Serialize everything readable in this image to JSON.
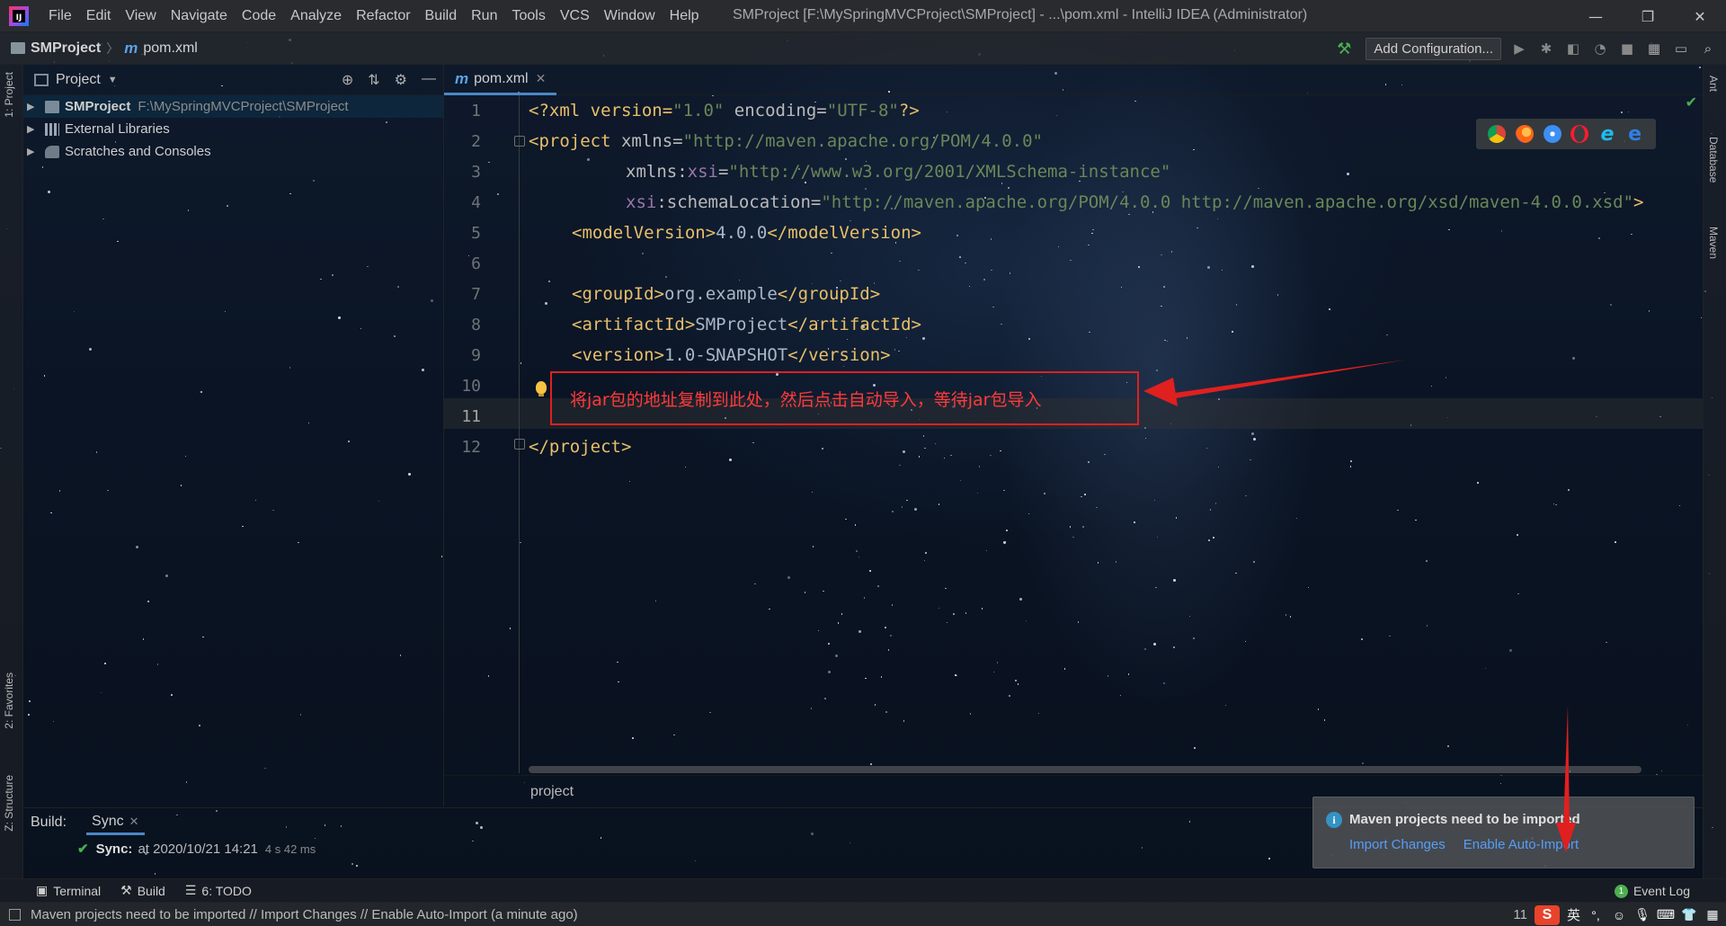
{
  "window": {
    "title": "SMProject [F:\\MySpringMVCProject\\SMProject] - ...\\pom.xml - IntelliJ IDEA (Administrator)",
    "controls": [
      "—",
      "❐",
      "✕"
    ]
  },
  "menu": [
    "File",
    "Edit",
    "View",
    "Navigate",
    "Code",
    "Analyze",
    "Refactor",
    "Build",
    "Run",
    "Tools",
    "VCS",
    "Window",
    "Help"
  ],
  "navbar": {
    "project": "SMProject",
    "file": "pom.xml",
    "add_configuration": "Add Configuration..."
  },
  "left_stripe": {
    "project_tab": "1: Project",
    "favorites_tab": "2: Favorites",
    "structure_tab": "Z: Structure"
  },
  "right_stripe": {
    "ant_tab": "Ant",
    "database_tab": "Database",
    "maven_tab": "Maven"
  },
  "project_panel": {
    "title": "Project",
    "tree": [
      {
        "label": "SMProject",
        "path": "F:\\MySpringMVCProject\\SMProject",
        "selected": true
      },
      {
        "label": "External Libraries",
        "path": ""
      },
      {
        "label": "Scratches and Consoles",
        "path": ""
      }
    ]
  },
  "editor": {
    "tab": "pom.xml",
    "current_line": 11,
    "line_numbers": [
      "1",
      "2",
      "3",
      "4",
      "5",
      "6",
      "7",
      "8",
      "9",
      "10",
      "11",
      "12"
    ],
    "code": {
      "l1_a": "<?xml version=",
      "l1_b": "\"1.0\"",
      "l1_c": " encoding=",
      "l1_d": "\"UTF-8\"",
      "l1_e": "?>",
      "l2_a": "<project ",
      "l2_b": "xmlns=",
      "l2_c": "\"http://maven.apache.org/POM/4.0.0\"",
      "l3_a": "xmlns:",
      "l3_b": "xsi",
      "l3_c": "=",
      "l3_d": "\"http://www.w3.org/2001/XMLSchema-instance\"",
      "l4_a": "xsi",
      "l4_b": ":schemaLocation=",
      "l4_c": "\"http://maven.apache.org/POM/4.0.0 http://maven.apache.org/xsd/maven-4.0.0.xsd\"",
      "l4_d": ">",
      "l5_a": "<modelVersion>",
      "l5_b": "4.0.0",
      "l5_c": "</modelVersion>",
      "l7_a": "<groupId>",
      "l7_b": "org.example",
      "l7_c": "</groupId>",
      "l8_a": "<artifactId>",
      "l8_b": "SMProject",
      "l8_c": "</artifactId>",
      "l9_a": "<version>",
      "l9_b": "1.0-SNAPSHOT",
      "l9_c": "</version>",
      "l12_a": "</project>"
    },
    "annotation": "将jar包的地址复制到此处，然后点击自动导入，等待jar包导入",
    "breadcrumb": "project"
  },
  "browser_icons": [
    "chrome-icon",
    "firefox-icon",
    "safari-icon",
    "opera-icon",
    "ie-icon",
    "edge-icon"
  ],
  "build_panel": {
    "label": "Build:",
    "tab": "Sync",
    "sync_label": "Sync:",
    "sync_text": "at 2020/10/21 14:21",
    "sync_time": "4 s 42 ms"
  },
  "notification": {
    "title": "Maven projects need to be imported",
    "import_changes": "Import Changes",
    "enable_auto_import": "Enable Auto-Import"
  },
  "bottom_tabs": {
    "terminal": "Terminal",
    "build": "Build",
    "todo": "6: TODO",
    "event_log": "Event Log",
    "event_count": "1"
  },
  "status": {
    "message": "Maven projects need to be imported // Import Changes // Enable Auto-Import (a minute ago)",
    "position": "11",
    "ime_lang": "英"
  },
  "colors": {
    "annotation_red": "#e0201f",
    "link_blue": "#589df6",
    "tag": "#e8bf6a",
    "string": "#6a8759"
  }
}
